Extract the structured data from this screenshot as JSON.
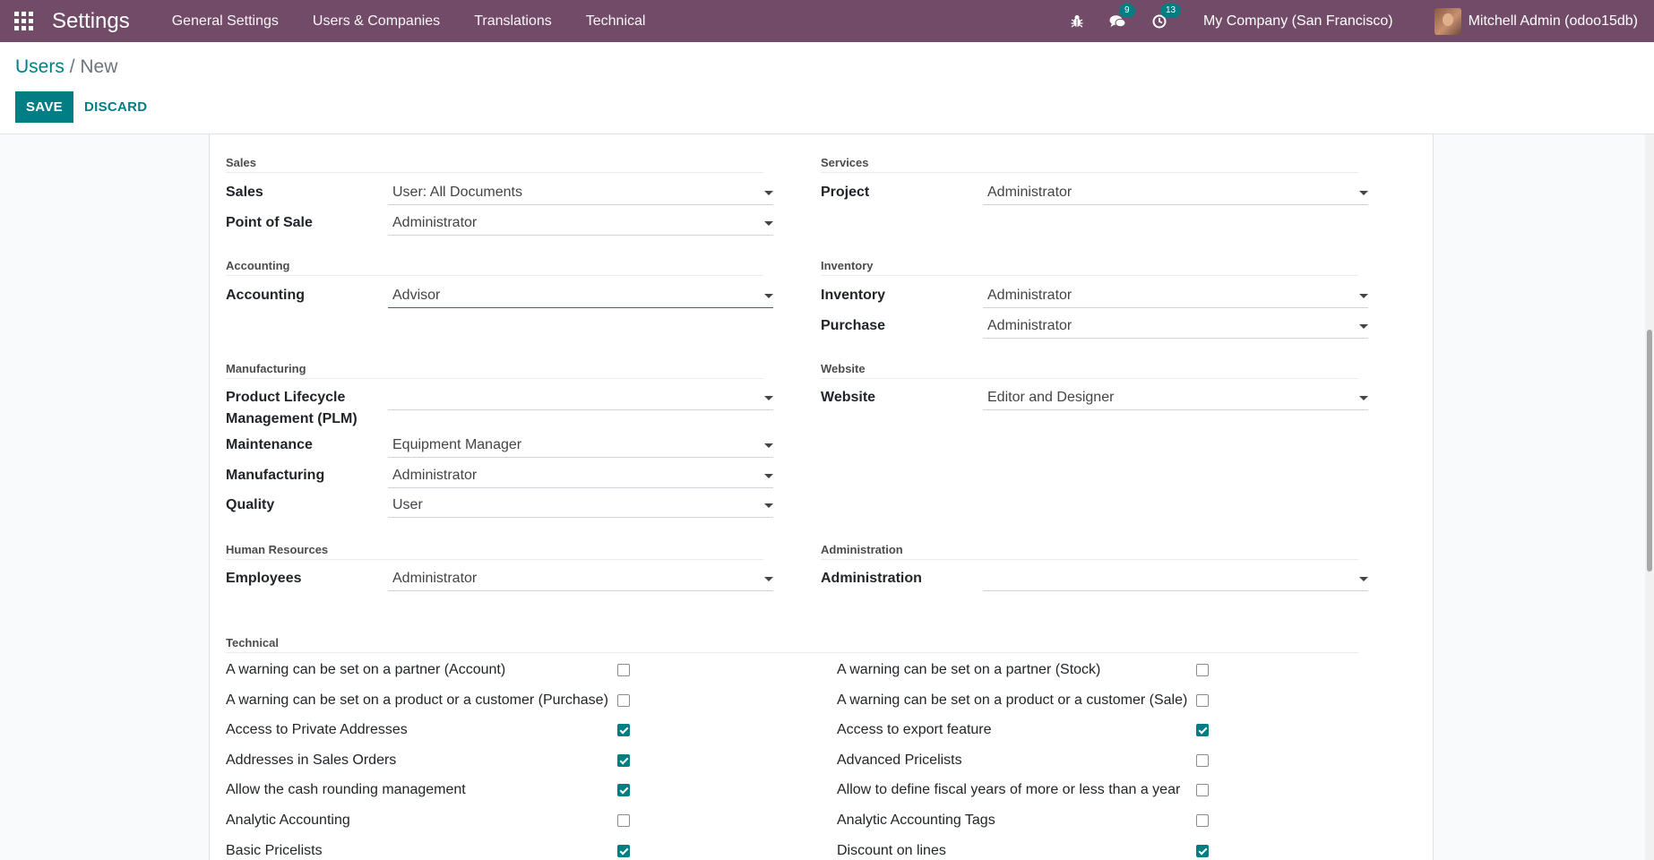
{
  "navbar": {
    "brand": "Settings",
    "menu": [
      "General Settings",
      "Users & Companies",
      "Translations",
      "Technical"
    ],
    "bug_icon": "bug-icon",
    "messages_badge": "9",
    "activity_badge": "13",
    "company": "My Company (San Francisco)",
    "user": "Mitchell Admin (odoo15db)",
    "bg_color": "#714b67"
  },
  "breadcrumb": {
    "parent": "Users",
    "separator": "/",
    "current": "New"
  },
  "buttons": {
    "save": "SAVE",
    "discard": "DISCARD"
  },
  "colors": {
    "accent": "#017e84"
  },
  "groups": {
    "sales": {
      "title": "Sales",
      "fields": [
        {
          "label": "Sales",
          "value": "User: All Documents"
        },
        {
          "label": "Point of Sale",
          "value": "Administrator"
        }
      ]
    },
    "services": {
      "title": "Services",
      "fields": [
        {
          "label": "Project",
          "value": "Administrator"
        }
      ]
    },
    "accounting": {
      "title": "Accounting",
      "fields": [
        {
          "label": "Accounting",
          "value": "Advisor"
        }
      ]
    },
    "inventory": {
      "title": "Inventory",
      "fields": [
        {
          "label": "Inventory",
          "value": "Administrator"
        },
        {
          "label": "Purchase",
          "value": "Administrator"
        }
      ]
    },
    "manufacturing": {
      "title": "Manufacturing",
      "fields": [
        {
          "label": "Product Lifecycle Management (PLM)",
          "value": ""
        },
        {
          "label": "Maintenance",
          "value": "Equipment Manager"
        },
        {
          "label": "Manufacturing",
          "value": "Administrator"
        },
        {
          "label": "Quality",
          "value": "User"
        }
      ]
    },
    "website": {
      "title": "Website",
      "fields": [
        {
          "label": "Website",
          "value": "Editor and Designer"
        }
      ]
    },
    "hr": {
      "title": "Human Resources",
      "fields": [
        {
          "label": "Employees",
          "value": "Administrator"
        }
      ]
    },
    "administration": {
      "title": "Administration",
      "fields": [
        {
          "label": "Administration",
          "value": ""
        }
      ]
    }
  },
  "technical": {
    "title": "Technical",
    "left": [
      {
        "label": "A warning can be set on a partner (Account)",
        "checked": false
      },
      {
        "label": "A warning can be set on a product or a customer (Purchase)",
        "checked": false
      },
      {
        "label": "Access to Private Addresses",
        "checked": true
      },
      {
        "label": "Addresses in Sales Orders",
        "checked": true
      },
      {
        "label": "Allow the cash rounding management",
        "checked": true
      },
      {
        "label": "Analytic Accounting",
        "checked": false
      },
      {
        "label": "Basic Pricelists",
        "checked": true
      }
    ],
    "right": [
      {
        "label": "A warning can be set on a partner (Stock)",
        "checked": false
      },
      {
        "label": "A warning can be set on a product or a customer (Sale)",
        "checked": false
      },
      {
        "label": "Access to export feature",
        "checked": true
      },
      {
        "label": "Advanced Pricelists",
        "checked": false
      },
      {
        "label": "Allow to define fiscal years of more or less than a year",
        "checked": false
      },
      {
        "label": "Analytic Accounting Tags",
        "checked": false
      },
      {
        "label": "Discount on lines",
        "checked": true
      }
    ]
  }
}
